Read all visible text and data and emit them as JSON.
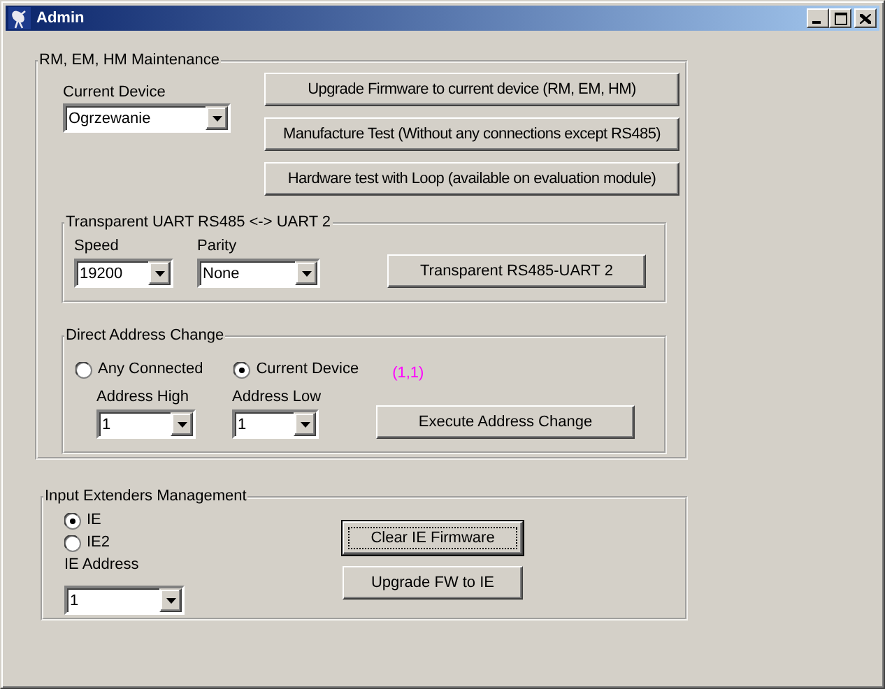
{
  "window": {
    "title": "Admin",
    "controls": [
      {
        "kind": "minimize"
      },
      {
        "kind": "maximize"
      },
      {
        "kind": "close"
      }
    ]
  },
  "maintenance": {
    "title": "RM, EM, HM Maintenance",
    "current_device": {
      "label": "Current Device",
      "value": "Ogrzewanie"
    },
    "buttons": [
      {
        "label": "Upgrade Firmware to current device (RM, EM, HM)",
        "focused": false
      },
      {
        "label": "Manufacture Test (Without any connections except RS485)",
        "focused": false
      },
      {
        "label": "Hardware test with Loop (available on evaluation module)",
        "focused": false
      }
    ],
    "uart": {
      "title": "Transparent UART RS485 <-> UART 2",
      "speed": {
        "label": "Speed",
        "value": "19200"
      },
      "parity": {
        "label": "Parity",
        "value": "None"
      },
      "button": {
        "label": "Transparent RS485-UART 2",
        "focused": false
      }
    },
    "address": {
      "title": "Direct Address Change",
      "options": [
        {
          "label": "Any Connected",
          "selected": false
        },
        {
          "label": "Current Device",
          "selected": true
        }
      ],
      "note": "(1,1)",
      "address_high": {
        "label": "Address High",
        "value": "1"
      },
      "address_low": {
        "label": "Address Low",
        "value": "1"
      },
      "button": {
        "label": "Execute Address Change",
        "focused": false
      }
    }
  },
  "extenders": {
    "title": "Input Extenders Management",
    "options": [
      {
        "label": "IE",
        "selected": true
      },
      {
        "label": "IE2",
        "selected": false
      }
    ],
    "ie_address": {
      "label": "IE Address",
      "value": "1"
    },
    "buttons": [
      {
        "label": "Clear IE Firmware",
        "focused": true
      },
      {
        "label": "Upgrade FW to IE",
        "focused": false
      }
    ]
  }
}
